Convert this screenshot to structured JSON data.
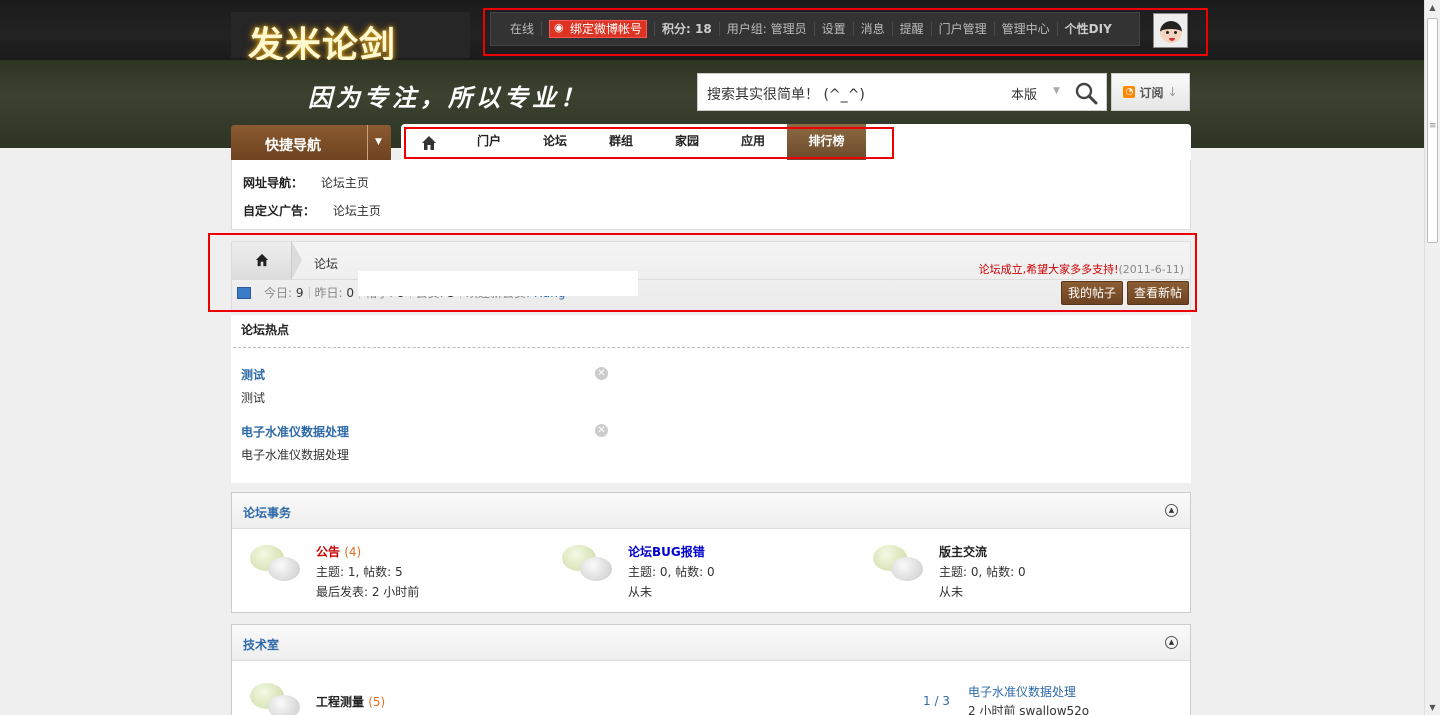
{
  "site": {
    "logo_text": "发米论剑",
    "slogan": "因为专注，所以专业！"
  },
  "usernav": {
    "online": "在线",
    "weibo_bind": "绑定微博帐号",
    "points_label": "积分: ",
    "points_value": "18",
    "usergroup": "用户组: 管理员",
    "settings": "设置",
    "messages": "消息",
    "reminders": "提醒",
    "portal_admin": "门户管理",
    "admin_center": "管理中心",
    "diy": "个性DIY"
  },
  "search": {
    "placeholder": "搜索其实很简单！ (^_^)",
    "scope": "本版"
  },
  "rss": {
    "label": "订阅",
    "arrow": "↓"
  },
  "quicknav": {
    "label": "快捷导航"
  },
  "mainnav": {
    "items": [
      "门户",
      "论坛",
      "群组",
      "家园",
      "应用"
    ],
    "active": "排行榜"
  },
  "subnav": {
    "url_nav_label": "网址导航：",
    "url_nav_value": "论坛主页",
    "custom_ad_label": "自定义广告：",
    "custom_ad_value": "论坛主页"
  },
  "crumbs": {
    "current": "论坛",
    "notice": "论坛成立,希望大家多多支持!",
    "notice_date": "(2011-6-11)"
  },
  "stats": {
    "today_label": "今日: ",
    "today": "9",
    "yesterday_label": "昨日: ",
    "yesterday": "0",
    "posts_label": "帖子: ",
    "posts": "8",
    "members_label": "会员: ",
    "members": "5",
    "newest_label": "欢迎新会员: ",
    "newest": "Hang"
  },
  "buttons": {
    "my_posts": "我的帖子",
    "new_posts": "查看新帖"
  },
  "hot": {
    "title": "论坛热点",
    "items": [
      {
        "title": "测试",
        "desc": "测试"
      },
      {
        "title": "电子水准仪数据处理",
        "desc": "电子水准仪数据处理"
      }
    ]
  },
  "section1": {
    "name": "论坛事务",
    "forums": [
      {
        "name": "公告",
        "count": "(4)",
        "stats": "主题: 1, 帖数: 5",
        "last": "最后发表: 2 小时前",
        "name_color": "#cc0000"
      },
      {
        "name": "论坛BUG报错",
        "count": "",
        "stats": "主题: 0, 帖数: 0",
        "last": "从未",
        "name_color": "#0000cc"
      },
      {
        "name": "版主交流",
        "count": "",
        "stats": "主题: 0, 帖数: 0",
        "last": "从未",
        "name_color": "#222222"
      }
    ]
  },
  "section2": {
    "name": "技术室",
    "forum": {
      "name": "工程测量",
      "count": "(5)",
      "ratio": "1 / 3",
      "last_title": "电子水准仪数据处理",
      "last_meta": "2 小时前 swallow52o"
    }
  }
}
